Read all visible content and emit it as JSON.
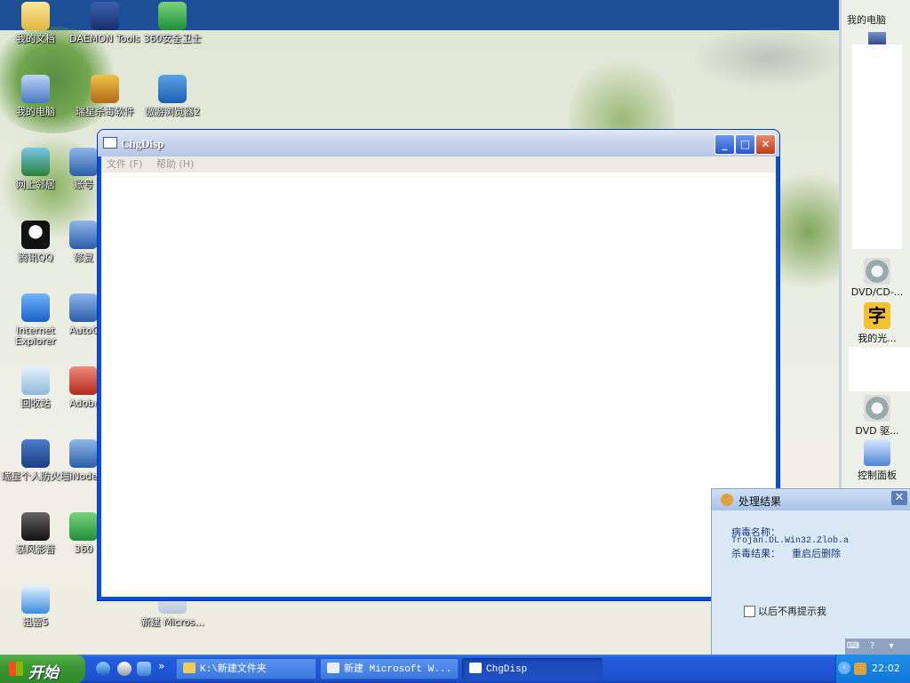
{
  "desktop": {
    "icons": [
      {
        "label": "我的文档"
      },
      {
        "label": "DAEMON Tools"
      },
      {
        "label": "360安全卫士"
      },
      {
        "label": "我的电脑"
      },
      {
        "label": "瑞星杀毒软件"
      },
      {
        "label": "傲游浏览器2"
      },
      {
        "label": "网上邻居"
      },
      {
        "label": "账号"
      },
      {
        "label": "腾讯QQ"
      },
      {
        "label": "修复"
      },
      {
        "label": "Internet Explorer"
      },
      {
        "label": "AutoC"
      },
      {
        "label": "回收站"
      },
      {
        "label": "Adobe"
      },
      {
        "label": "瑞星个人防火墙"
      },
      {
        "label": "iNode"
      },
      {
        "label": "暴风影音"
      },
      {
        "label": "360"
      },
      {
        "label": "迅雷5"
      },
      {
        "label": "新建 Micros..."
      }
    ]
  },
  "window": {
    "title": "ChgDisp",
    "menu": [
      "文件 (F)",
      "帮助 (H)"
    ],
    "controls": {
      "minimize": "_",
      "maximize": "□",
      "close": "✕"
    }
  },
  "sidebar": {
    "header": "我的电脑",
    "items": [
      {
        "label": "DVD/CD-..."
      },
      {
        "label": "我的光..."
      },
      {
        "label": "DVD 驱..."
      },
      {
        "label": "控制面板"
      }
    ]
  },
  "popup": {
    "title": "处理结果",
    "virus_label": "病毒名称：",
    "virus_name": "Trojan.DL.Win32.Zlob.a",
    "result_label": "杀毒结果：",
    "result_value": "重启后删除",
    "checkbox_label": "以后不再提示我",
    "close": "✕"
  },
  "taskbar": {
    "start": "开始",
    "chevron": "»",
    "buttons": [
      {
        "label": "K:\\新建文件夹"
      },
      {
        "label": "新建 Microsoft W..."
      },
      {
        "label": "ChgDisp"
      }
    ],
    "clock": "22:02"
  },
  "colors": {
    "taskbar": "#245edb",
    "start_button": "#3c9a34",
    "window_frame": "#0a4fd8",
    "popup_bg": "#dbe9f6"
  }
}
